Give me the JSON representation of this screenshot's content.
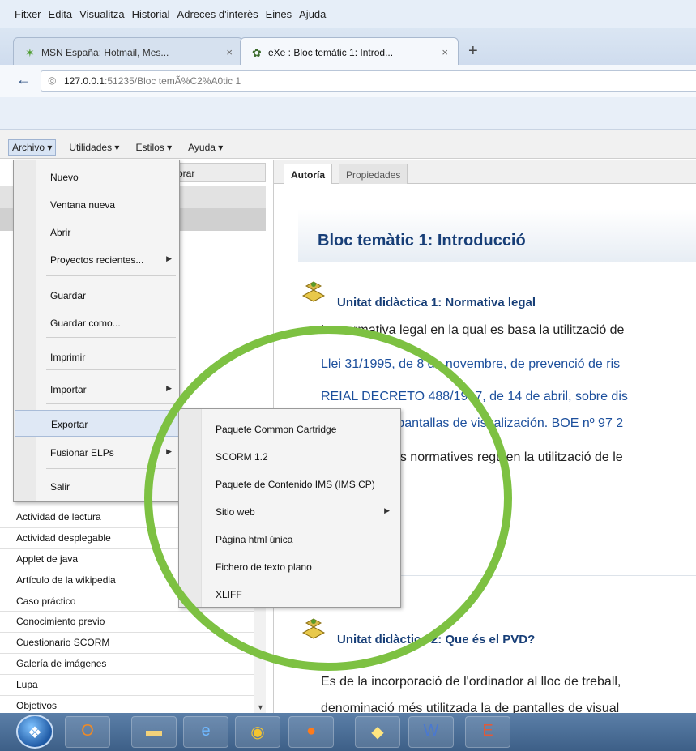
{
  "firefox": {
    "menubar": [
      {
        "pre": "",
        "key": "F",
        "post": "itxer"
      },
      {
        "pre": "",
        "key": "E",
        "post": "dita"
      },
      {
        "pre": "",
        "key": "V",
        "post": "isualitza"
      },
      {
        "pre": "Hi",
        "key": "s",
        "post": "torial"
      },
      {
        "pre": "Ad",
        "key": "r",
        "post": "eces d'interès"
      },
      {
        "pre": "Ei",
        "key": "n",
        "post": "es"
      },
      {
        "pre": "A",
        "key": "j",
        "post": "uda"
      }
    ],
    "tabs": [
      {
        "title": "MSN España: Hotmail, Mes...",
        "close": "×",
        "active": false
      },
      {
        "title": "eXe : Bloc temàtic 1: Introd...",
        "close": "×",
        "active": true
      }
    ],
    "new_tab": "+",
    "url_host": "127.0.0.1",
    "url_rest": ":51235/Bloc temÃ%C2%A0tic 1"
  },
  "app_menubar": [
    {
      "label": "Archivo ▾",
      "open": true
    },
    {
      "label": "Utilidades ▾",
      "open": false
    },
    {
      "label": "Estilos ▾",
      "open": false
    },
    {
      "label": "Ayuda ▾",
      "open": false
    }
  ],
  "left_pane": {
    "header_tab": "mbrar",
    "idevices": [
      "Actividad de lectura",
      "Actividad desplegable",
      "Applet de java",
      "Artículo de la wikipedia",
      "Caso práctico",
      "Conocimiento previo",
      "Cuestionario SCORM",
      "Galería de imágenes",
      "Lupa",
      "Objetivos"
    ],
    "scroll_down": "▼"
  },
  "archivo_menu": [
    {
      "label": "Nuevo",
      "submenu": false,
      "highlighted": false
    },
    {
      "label": "Ventana nueva",
      "submenu": false,
      "highlighted": false
    },
    {
      "label": "Abrir",
      "submenu": false,
      "highlighted": false
    },
    {
      "label": "Proyectos recientes...",
      "submenu": true,
      "highlighted": false
    },
    {
      "label": "Guardar",
      "submenu": false,
      "highlighted": false
    },
    {
      "label": "Guardar como...",
      "submenu": false,
      "highlighted": false
    },
    {
      "label": "Imprimir",
      "submenu": false,
      "highlighted": false
    },
    {
      "label": "Importar",
      "submenu": true,
      "highlighted": false
    },
    {
      "label": "Exportar",
      "submenu": true,
      "highlighted": true
    },
    {
      "label": "Fusionar ELPs",
      "submenu": true,
      "highlighted": false
    },
    {
      "label": "Salir",
      "submenu": false,
      "highlighted": false
    }
  ],
  "export_submenu": [
    {
      "label": "Paquete Common Cartridge",
      "submenu": false
    },
    {
      "label": "SCORM 1.2",
      "submenu": false
    },
    {
      "label": "Paquete de Contenido IMS (IMS CP)",
      "submenu": false
    },
    {
      "label": "Sitio web",
      "submenu": true
    },
    {
      "label": "Página html única",
      "submenu": false
    },
    {
      "label": "Fichero de texto plano",
      "submenu": false
    },
    {
      "label": "XLIFF",
      "submenu": false
    }
  ],
  "submenu_arrow": "▶",
  "content": {
    "tabs": [
      {
        "label": "Autoría",
        "active": true
      },
      {
        "label": "Propiedades",
        "active": false
      }
    ],
    "title": "Bloc temàtic 1: Introducció",
    "unit1_heading": "Unitat didàctica 1: Normativa legal",
    "unit1_paragraphs": [
      {
        "text": "La normativa legal en la qual es basa la utilització de",
        "style": "black"
      },
      {
        "text": "Llei 31/1995, de 8 de novembre, de prevenció de ris",
        "style": "blue"
      },
      {
        "text": "REIAL DECRETO 488/1997, de 14 de abril, sobre dis",
        "style": "blue"
      },
      {
        "text": "que incluyen pantallas de visualización. BOE nº 97 2",
        "style": "blue"
      },
      {
        "text": "Aquestes dues normatives regulen la utilització de le",
        "style": "black"
      }
    ],
    "unit2_heading": "Unitat didàctica 2: Que és el PVD?",
    "unit2_paragraphs": [
      {
        "text": "Es de la incorporació de l'ordinador al lloc de treball,",
        "style": "black"
      },
      {
        "text": "denominació més utilitzada la de pantalles de visual",
        "style": "black"
      }
    ]
  },
  "colors": {
    "annotation_circle": "#7dc142",
    "title_blue": "#173e77",
    "link_blue": "#1c4f9c"
  },
  "taskbar": {
    "items": [
      {
        "icon": "outlook-icon",
        "glyph": "O"
      },
      {
        "icon": "folder-icon",
        "glyph": "▬"
      },
      {
        "icon": "internet-explorer-icon",
        "glyph": "e"
      },
      {
        "icon": "chrome-icon",
        "glyph": "◉"
      },
      {
        "icon": "firefox-icon",
        "glyph": "●"
      },
      {
        "icon": "notes-icon",
        "glyph": "◆"
      },
      {
        "icon": "word-icon",
        "glyph": "W"
      },
      {
        "icon": "exe-icon",
        "glyph": "E"
      }
    ]
  }
}
